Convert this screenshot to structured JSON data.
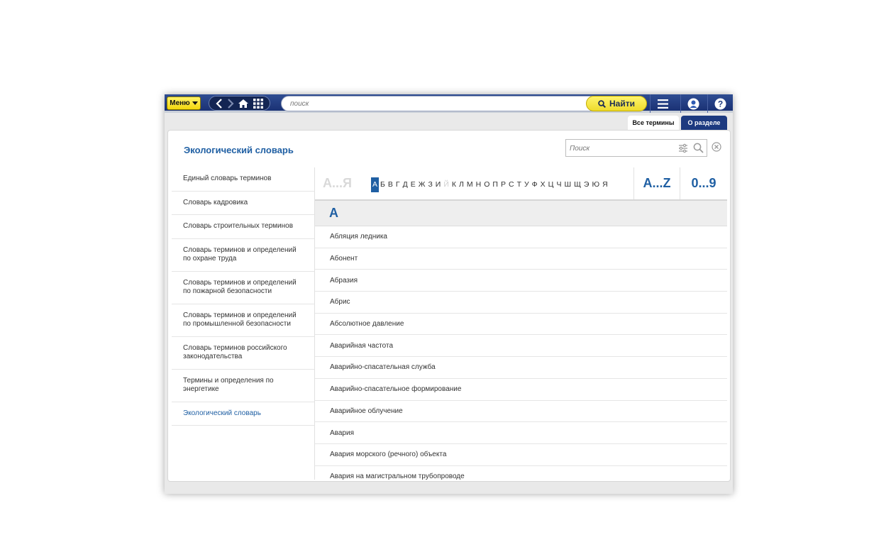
{
  "toolbar": {
    "menu_label": "Меню",
    "search_placeholder": "поиск",
    "find_label": "Найти"
  },
  "tabs": [
    {
      "label": "Все термины"
    },
    {
      "label": "О разделе"
    }
  ],
  "page": {
    "title": "Экологический словарь",
    "filter_placeholder": "Поиск"
  },
  "sidebar": {
    "items": [
      {
        "label": "Единый словарь терминов"
      },
      {
        "label": "Словарь кадровика"
      },
      {
        "label": "Словарь строительных терминов"
      },
      {
        "label": "Словарь терминов и определений по охране труда"
      },
      {
        "label": "Словарь терминов и определений по пожарной безопасности"
      },
      {
        "label": "Словарь терминов и определений по промышленной безопасности"
      },
      {
        "label": "Словарь терминов российского законодательства"
      },
      {
        "label": "Термины и определения по энергетике"
      },
      {
        "label": "Экологический словарь"
      }
    ],
    "active_index": 8
  },
  "alphabet": {
    "cyr_range": "А...Я",
    "letters": [
      "А",
      "Б",
      "В",
      "Г",
      "Д",
      "Е",
      "Ж",
      "З",
      "И",
      "Й",
      "К",
      "Л",
      "М",
      "Н",
      "О",
      "П",
      "Р",
      "С",
      "Т",
      "У",
      "Ф",
      "Х",
      "Ц",
      "Ч",
      "Ш",
      "Щ",
      "Э",
      "Ю",
      "Я"
    ],
    "active": "А",
    "disabled": [
      "Й"
    ],
    "latin_range": "A...Z",
    "digit_range": "0...9"
  },
  "section": {
    "letter": "А"
  },
  "terms": [
    "Абляция ледника",
    "Абонент",
    "Абразия",
    "Абрис",
    "Абсолютное давление",
    "Аварийная частота",
    "Аварийно-спасательная служба",
    "Аварийно-спасательное формирование",
    "Аварийное облучение",
    "Авария",
    "Авария морского (речного) объекта",
    "Авария на магистральном трубопроводе"
  ]
}
